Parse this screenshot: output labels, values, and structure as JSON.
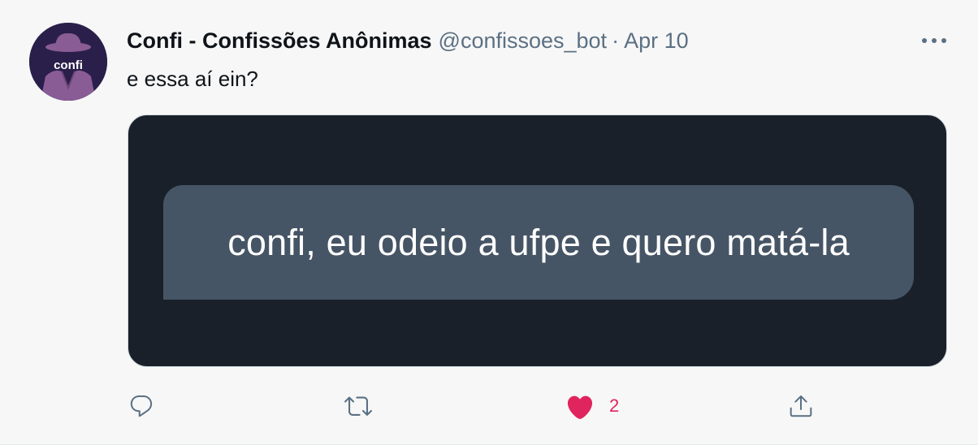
{
  "tweet": {
    "display_name": "Confi - Confissões Anônimas",
    "handle": "@confissoes_bot",
    "separator": "·",
    "date": "Apr 10",
    "text": "e essa aí ein?",
    "avatar_text": "confi",
    "media": {
      "bubble_text": "confi, eu odeio a ufpe e quero matá-la"
    },
    "actions": {
      "reply_icon": "reply-icon",
      "retweet_icon": "retweet-icon",
      "like_icon": "heart-icon",
      "like_count": "2",
      "share_icon": "share-icon"
    }
  },
  "colors": {
    "like": "#e0245e",
    "secondary_text": "#5b7083",
    "media_background": "#19202a",
    "bubble": "#465565",
    "avatar_background": "#2a1f4a",
    "avatar_figure": "#8a5c96"
  }
}
